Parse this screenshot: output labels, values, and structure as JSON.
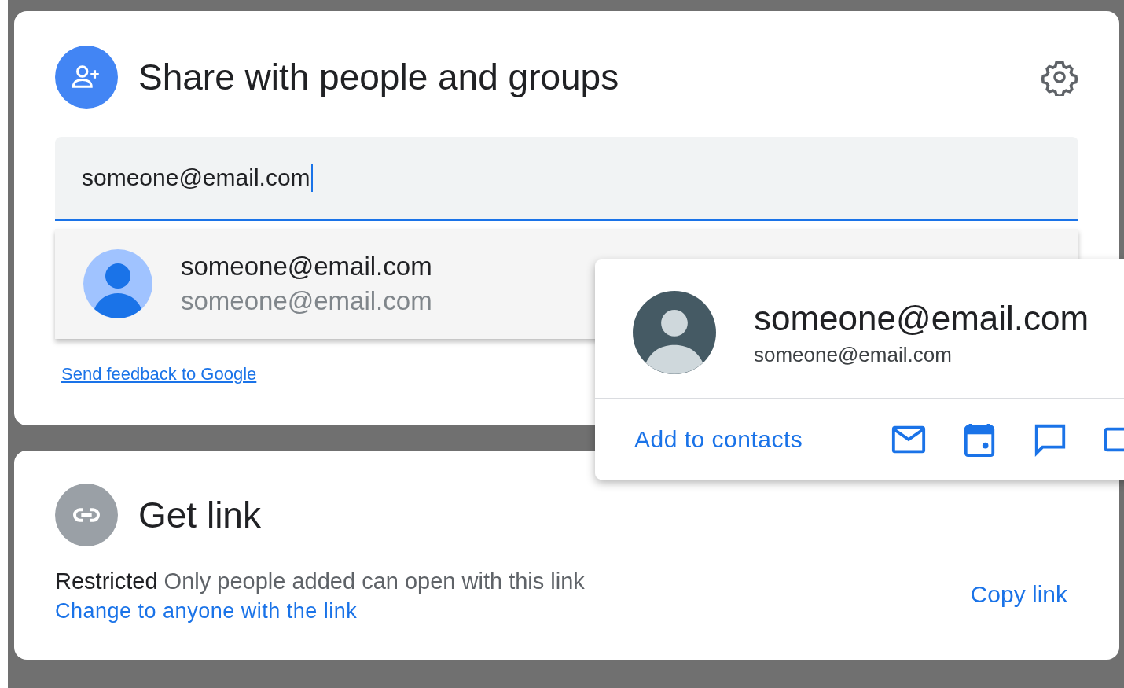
{
  "share": {
    "title": "Share with people and groups",
    "input": {
      "value": "someone@email.com",
      "focused": true
    },
    "suggestions": [
      {
        "name": "someone@email.com",
        "email": "someone@email.com"
      }
    ],
    "feedback_link": "Send feedback to Google"
  },
  "contact_card": {
    "name": "someone@email.com",
    "email": "someone@email.com",
    "action": "Add to contacts"
  },
  "get_link": {
    "title": "Get link",
    "description": "**Restricted** Only people added can open with this link",
    "change_link": "Change to anyone with the link",
    "copy_button": "Copy link"
  }
}
